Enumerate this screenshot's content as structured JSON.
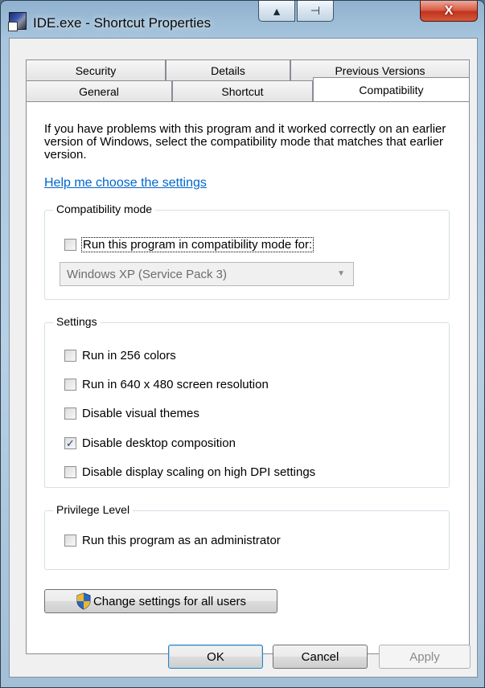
{
  "window": {
    "title": "IDE.exe - Shortcut Properties"
  },
  "title_tools": {
    "up_glyph": "▲",
    "pin_glyph": "⊣"
  },
  "close_glyph": "X",
  "tabs": {
    "row1": [
      "Security",
      "Details",
      "Previous Versions"
    ],
    "row2": [
      "General",
      "Shortcut",
      "Compatibility"
    ],
    "selected": "Compatibility"
  },
  "intro_text": "If you have problems with this program and it worked correctly on an earlier version of Windows, select the compatibility mode that matches that earlier version.",
  "help_link": "Help me choose the settings",
  "compat_mode": {
    "label": "Compatibility mode",
    "checkbox_label": "Run this program in compatibility mode for:",
    "checked": false,
    "selected_mode": "Windows XP (Service Pack 3)"
  },
  "settings": {
    "label": "Settings",
    "items": [
      {
        "label": "Run in 256 colors",
        "checked": false
      },
      {
        "label": "Run in 640 x 480 screen resolution",
        "checked": false
      },
      {
        "label": "Disable visual themes",
        "checked": false
      },
      {
        "label": "Disable desktop composition",
        "checked": true
      },
      {
        "label": "Disable display scaling on high DPI settings",
        "checked": false
      }
    ]
  },
  "privilege": {
    "label": "Privilege Level",
    "checkbox_label": "Run this program as an administrator",
    "checked": false
  },
  "change_all_button": "Change settings for all users",
  "footer": {
    "ok": "OK",
    "cancel": "Cancel",
    "apply": "Apply"
  },
  "check_glyph": "✓"
}
